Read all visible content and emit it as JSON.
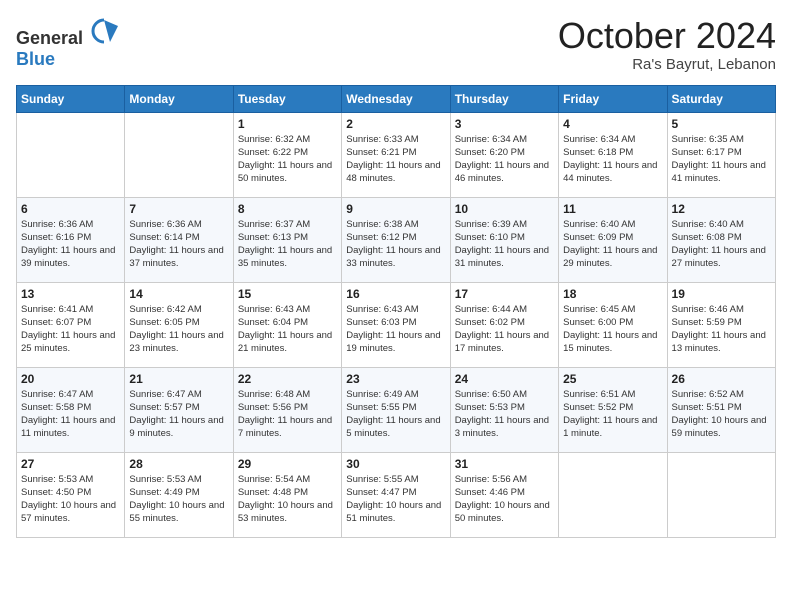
{
  "header": {
    "logo_general": "General",
    "logo_blue": "Blue",
    "month": "October 2024",
    "location": "Ra's Bayrut, Lebanon"
  },
  "days_of_week": [
    "Sunday",
    "Monday",
    "Tuesday",
    "Wednesday",
    "Thursday",
    "Friday",
    "Saturday"
  ],
  "weeks": [
    [
      {
        "day": "",
        "sunrise": "",
        "sunset": "",
        "daylight": ""
      },
      {
        "day": "",
        "sunrise": "",
        "sunset": "",
        "daylight": ""
      },
      {
        "day": "1",
        "sunrise": "Sunrise: 6:32 AM",
        "sunset": "Sunset: 6:22 PM",
        "daylight": "Daylight: 11 hours and 50 minutes."
      },
      {
        "day": "2",
        "sunrise": "Sunrise: 6:33 AM",
        "sunset": "Sunset: 6:21 PM",
        "daylight": "Daylight: 11 hours and 48 minutes."
      },
      {
        "day": "3",
        "sunrise": "Sunrise: 6:34 AM",
        "sunset": "Sunset: 6:20 PM",
        "daylight": "Daylight: 11 hours and 46 minutes."
      },
      {
        "day": "4",
        "sunrise": "Sunrise: 6:34 AM",
        "sunset": "Sunset: 6:18 PM",
        "daylight": "Daylight: 11 hours and 44 minutes."
      },
      {
        "day": "5",
        "sunrise": "Sunrise: 6:35 AM",
        "sunset": "Sunset: 6:17 PM",
        "daylight": "Daylight: 11 hours and 41 minutes."
      }
    ],
    [
      {
        "day": "6",
        "sunrise": "Sunrise: 6:36 AM",
        "sunset": "Sunset: 6:16 PM",
        "daylight": "Daylight: 11 hours and 39 minutes."
      },
      {
        "day": "7",
        "sunrise": "Sunrise: 6:36 AM",
        "sunset": "Sunset: 6:14 PM",
        "daylight": "Daylight: 11 hours and 37 minutes."
      },
      {
        "day": "8",
        "sunrise": "Sunrise: 6:37 AM",
        "sunset": "Sunset: 6:13 PM",
        "daylight": "Daylight: 11 hours and 35 minutes."
      },
      {
        "day": "9",
        "sunrise": "Sunrise: 6:38 AM",
        "sunset": "Sunset: 6:12 PM",
        "daylight": "Daylight: 11 hours and 33 minutes."
      },
      {
        "day": "10",
        "sunrise": "Sunrise: 6:39 AM",
        "sunset": "Sunset: 6:10 PM",
        "daylight": "Daylight: 11 hours and 31 minutes."
      },
      {
        "day": "11",
        "sunrise": "Sunrise: 6:40 AM",
        "sunset": "Sunset: 6:09 PM",
        "daylight": "Daylight: 11 hours and 29 minutes."
      },
      {
        "day": "12",
        "sunrise": "Sunrise: 6:40 AM",
        "sunset": "Sunset: 6:08 PM",
        "daylight": "Daylight: 11 hours and 27 minutes."
      }
    ],
    [
      {
        "day": "13",
        "sunrise": "Sunrise: 6:41 AM",
        "sunset": "Sunset: 6:07 PM",
        "daylight": "Daylight: 11 hours and 25 minutes."
      },
      {
        "day": "14",
        "sunrise": "Sunrise: 6:42 AM",
        "sunset": "Sunset: 6:05 PM",
        "daylight": "Daylight: 11 hours and 23 minutes."
      },
      {
        "day": "15",
        "sunrise": "Sunrise: 6:43 AM",
        "sunset": "Sunset: 6:04 PM",
        "daylight": "Daylight: 11 hours and 21 minutes."
      },
      {
        "day": "16",
        "sunrise": "Sunrise: 6:43 AM",
        "sunset": "Sunset: 6:03 PM",
        "daylight": "Daylight: 11 hours and 19 minutes."
      },
      {
        "day": "17",
        "sunrise": "Sunrise: 6:44 AM",
        "sunset": "Sunset: 6:02 PM",
        "daylight": "Daylight: 11 hours and 17 minutes."
      },
      {
        "day": "18",
        "sunrise": "Sunrise: 6:45 AM",
        "sunset": "Sunset: 6:00 PM",
        "daylight": "Daylight: 11 hours and 15 minutes."
      },
      {
        "day": "19",
        "sunrise": "Sunrise: 6:46 AM",
        "sunset": "Sunset: 5:59 PM",
        "daylight": "Daylight: 11 hours and 13 minutes."
      }
    ],
    [
      {
        "day": "20",
        "sunrise": "Sunrise: 6:47 AM",
        "sunset": "Sunset: 5:58 PM",
        "daylight": "Daylight: 11 hours and 11 minutes."
      },
      {
        "day": "21",
        "sunrise": "Sunrise: 6:47 AM",
        "sunset": "Sunset: 5:57 PM",
        "daylight": "Daylight: 11 hours and 9 minutes."
      },
      {
        "day": "22",
        "sunrise": "Sunrise: 6:48 AM",
        "sunset": "Sunset: 5:56 PM",
        "daylight": "Daylight: 11 hours and 7 minutes."
      },
      {
        "day": "23",
        "sunrise": "Sunrise: 6:49 AM",
        "sunset": "Sunset: 5:55 PM",
        "daylight": "Daylight: 11 hours and 5 minutes."
      },
      {
        "day": "24",
        "sunrise": "Sunrise: 6:50 AM",
        "sunset": "Sunset: 5:53 PM",
        "daylight": "Daylight: 11 hours and 3 minutes."
      },
      {
        "day": "25",
        "sunrise": "Sunrise: 6:51 AM",
        "sunset": "Sunset: 5:52 PM",
        "daylight": "Daylight: 11 hours and 1 minute."
      },
      {
        "day": "26",
        "sunrise": "Sunrise: 6:52 AM",
        "sunset": "Sunset: 5:51 PM",
        "daylight": "Daylight: 10 hours and 59 minutes."
      }
    ],
    [
      {
        "day": "27",
        "sunrise": "Sunrise: 5:53 AM",
        "sunset": "Sunset: 4:50 PM",
        "daylight": "Daylight: 10 hours and 57 minutes."
      },
      {
        "day": "28",
        "sunrise": "Sunrise: 5:53 AM",
        "sunset": "Sunset: 4:49 PM",
        "daylight": "Daylight: 10 hours and 55 minutes."
      },
      {
        "day": "29",
        "sunrise": "Sunrise: 5:54 AM",
        "sunset": "Sunset: 4:48 PM",
        "daylight": "Daylight: 10 hours and 53 minutes."
      },
      {
        "day": "30",
        "sunrise": "Sunrise: 5:55 AM",
        "sunset": "Sunset: 4:47 PM",
        "daylight": "Daylight: 10 hours and 51 minutes."
      },
      {
        "day": "31",
        "sunrise": "Sunrise: 5:56 AM",
        "sunset": "Sunset: 4:46 PM",
        "daylight": "Daylight: 10 hours and 50 minutes."
      },
      {
        "day": "",
        "sunrise": "",
        "sunset": "",
        "daylight": ""
      },
      {
        "day": "",
        "sunrise": "",
        "sunset": "",
        "daylight": ""
      }
    ]
  ]
}
